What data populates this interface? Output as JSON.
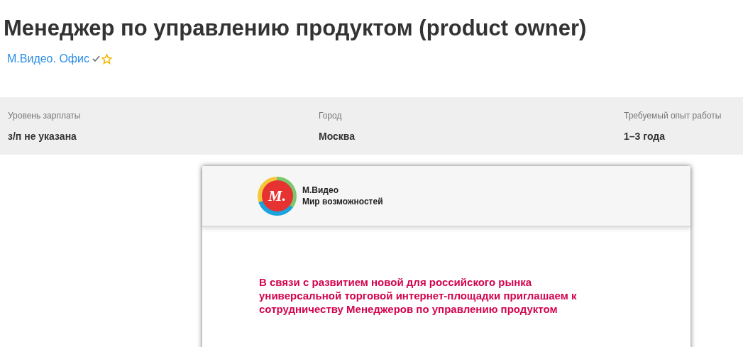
{
  "title": "Менеджер по управлению продуктом (product owner)",
  "company": {
    "name": "М.Видео. Офис",
    "verified": true,
    "favorite": false
  },
  "facts": [
    {
      "label": "Уровень зарплаты",
      "value": "з/п не указана"
    },
    {
      "label": "Город",
      "value": "Москва"
    },
    {
      "label": "Требуемый опыт работы",
      "value": "1–3 года"
    }
  ],
  "letter": {
    "logo_mark": "М.",
    "brand": "М.Видео",
    "slogan": "Мир возможностей",
    "intro": "В связи с развитием новой для российского рынка универсальной торговой интернет-площадки приглашаем к сотрудничеству Менеджеров по управлению продуктом"
  }
}
